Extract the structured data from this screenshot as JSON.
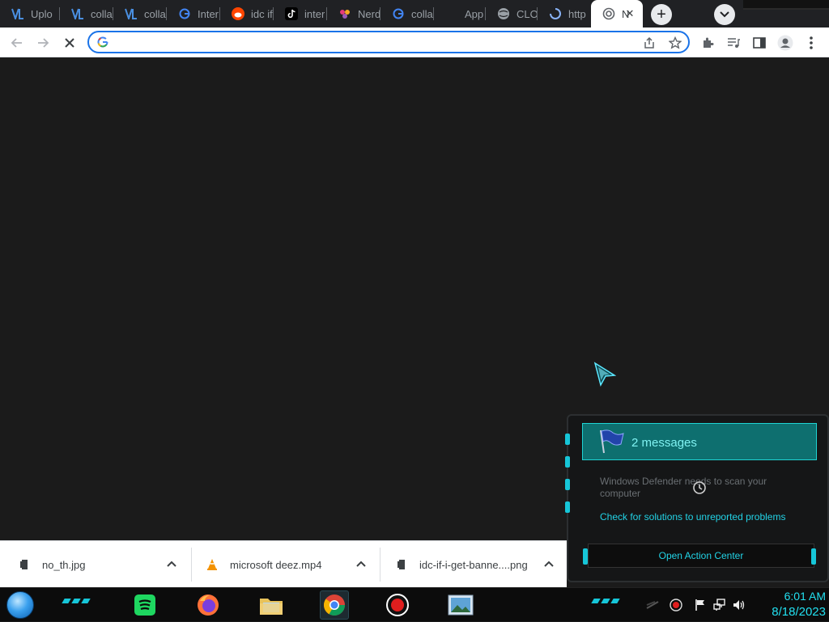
{
  "tabs": [
    {
      "label": "Uplo",
      "icon": "vl-logo-icon"
    },
    {
      "label": "colla",
      "icon": "vl-logo-icon"
    },
    {
      "label": "colla",
      "icon": "vl-logo-icon"
    },
    {
      "label": "Inter",
      "icon": "google-g-icon"
    },
    {
      "label": "idc if",
      "icon": "reddit-icon"
    },
    {
      "label": "inter",
      "icon": "tiktok-icon"
    },
    {
      "label": "Nerd",
      "icon": "pinwheel-icon"
    },
    {
      "label": "colla",
      "icon": "google-g-icon"
    },
    {
      "label": "App",
      "icon": "blank-icon"
    },
    {
      "label": "CLO",
      "icon": "globe-icon"
    },
    {
      "label": "http",
      "icon": "loading-icon"
    },
    {
      "label": "N",
      "icon": "spinner-icon",
      "active": true
    }
  ],
  "toolbar": {
    "url_value": "",
    "buttons": [
      "back-icon",
      "forward-icon",
      "stop-icon",
      "share-icon",
      "star-icon",
      "extensions-icon",
      "media-icon",
      "side-panel-icon",
      "profile-icon",
      "menu-icon"
    ]
  },
  "downloads": [
    {
      "name": "no_th.jpg",
      "icon": "file-icon"
    },
    {
      "name": "microsoft deez.mp4",
      "icon": "vlc-cone-icon"
    },
    {
      "name": "idc-if-i-get-banne....png",
      "icon": "file-icon"
    }
  ],
  "notification": {
    "header": "2 messages",
    "items": [
      "Windows Defender needs to scan your computer",
      "Check for solutions to unreported problems"
    ],
    "action": "Open Action Center"
  },
  "taskbar": {
    "apps": [
      "start-orb",
      "spotify",
      "firefox",
      "file-explorer",
      "chrome",
      "recorder",
      "photos"
    ],
    "tray": [
      "record-icon",
      "flag-icon",
      "network-icon",
      "volume-icon"
    ],
    "time": "6:01 AM",
    "date": "8/18/2023"
  },
  "colors": {
    "accent": "#22d3e6",
    "notification_header": "#0e6f6f",
    "chrome_tab_bg": "#202124"
  }
}
